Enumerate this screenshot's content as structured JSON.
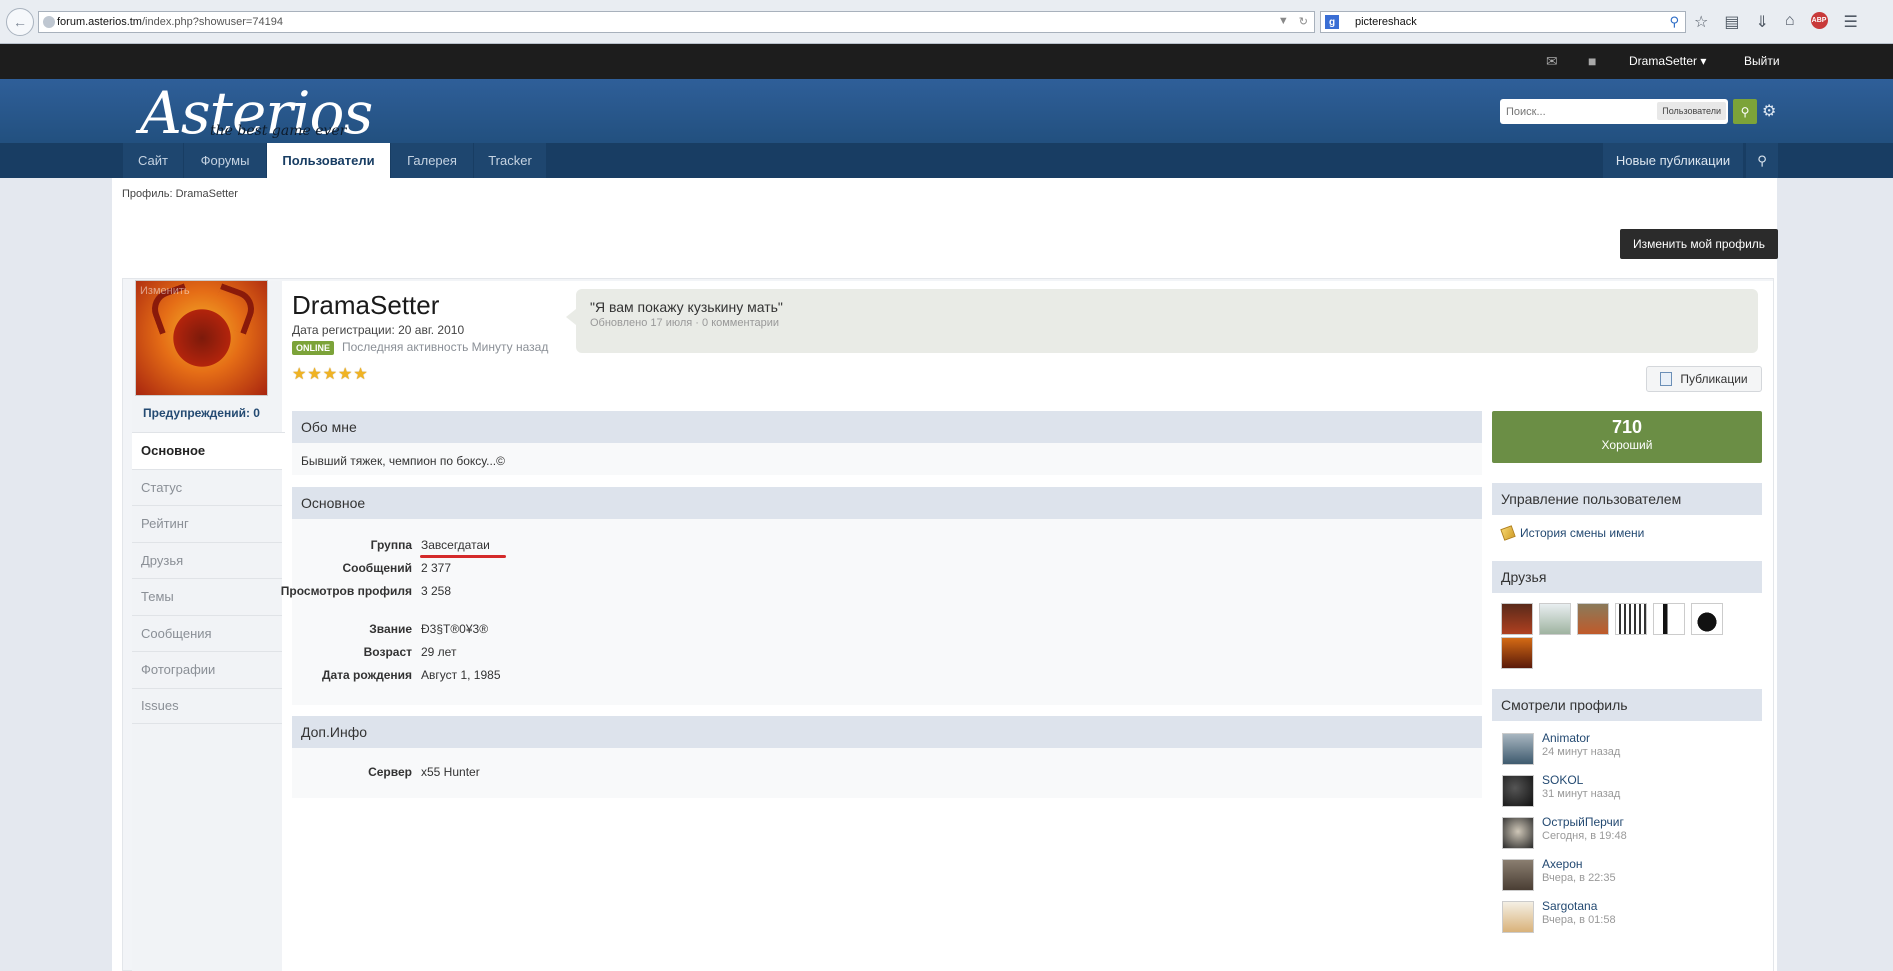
{
  "browser": {
    "url_host": "forum.asterios.tm",
    "url_path": "/index.php?showuser=74194",
    "search_query": "pictereshack"
  },
  "userbar": {
    "username": "DramaSetter",
    "logout": "Выйти"
  },
  "header": {
    "logo": "Asterios",
    "logo_sub": "the best game ever",
    "search_placeholder": "Поиск...",
    "search_scope": "Пользователи"
  },
  "nav": {
    "tabs": [
      "Сайт",
      "Форумы",
      "Пользователи",
      "Галерея",
      "Tracker"
    ],
    "active": "Пользователи",
    "new_posts": "Новые публикации"
  },
  "breadcrumb": "Профиль: DramaSetter",
  "edit_profile": "Изменить мой профиль",
  "profile": {
    "avatar_overlay": "Изменить",
    "warnings": "Предупреждений: 0",
    "menu": [
      "Основное",
      "Статус",
      "Рейтинг",
      "Друзья",
      "Темы",
      "Сообщения",
      "Фотографии",
      "Issues"
    ],
    "username": "DramaSetter",
    "reg_date": "Дата регистрации: 20 авг. 2010",
    "online": "ONLINE",
    "last_activity": "Последняя активность Минуту назад",
    "rating_stars": 5,
    "status_text": "\"Я вам покажу кузькину мать\"",
    "status_meta": "Обновлено 17 июля · 0 комментарии",
    "publications_button": "Публикации"
  },
  "sections": {
    "about_title": "Обо мне",
    "about_text": "Бывший тяжек, чемпион по боксу...©",
    "main_title": "Основное",
    "main_rows": [
      {
        "label": "Группа",
        "value": "Завсегдатаи"
      },
      {
        "label": "Сообщений",
        "value": "2 377"
      },
      {
        "label": "Просмотров профиля",
        "value": "3 258"
      },
      {
        "label": "Звание",
        "value": "Ð3§T®0¥3®"
      },
      {
        "label": "Возраст",
        "value": "29 лет"
      },
      {
        "label": "Дата рождения",
        "value": "Август 1, 1985"
      }
    ],
    "extra_title": "Доп.Инфо",
    "extra_rows": [
      {
        "label": "Сервер",
        "value": "x55 Hunter"
      }
    ]
  },
  "sidebar": {
    "reputation_value": "710",
    "reputation_label": "Хороший",
    "manage_title": "Управление пользователем",
    "name_history": "История смены имени",
    "friends_title": "Друзья",
    "viewers_title": "Смотрели профиль",
    "viewers": [
      {
        "name": "Animator",
        "time": "24 минут назад"
      },
      {
        "name": "SOKOL",
        "time": "31 минут назад"
      },
      {
        "name": "ОстрыйПерчиг",
        "time": "Сегодня, в 19:48"
      },
      {
        "name": "Ахерон",
        "time": "Вчера, в 22:35"
      },
      {
        "name": "Sargotana",
        "time": "Вчера, в 01:58"
      }
    ]
  }
}
